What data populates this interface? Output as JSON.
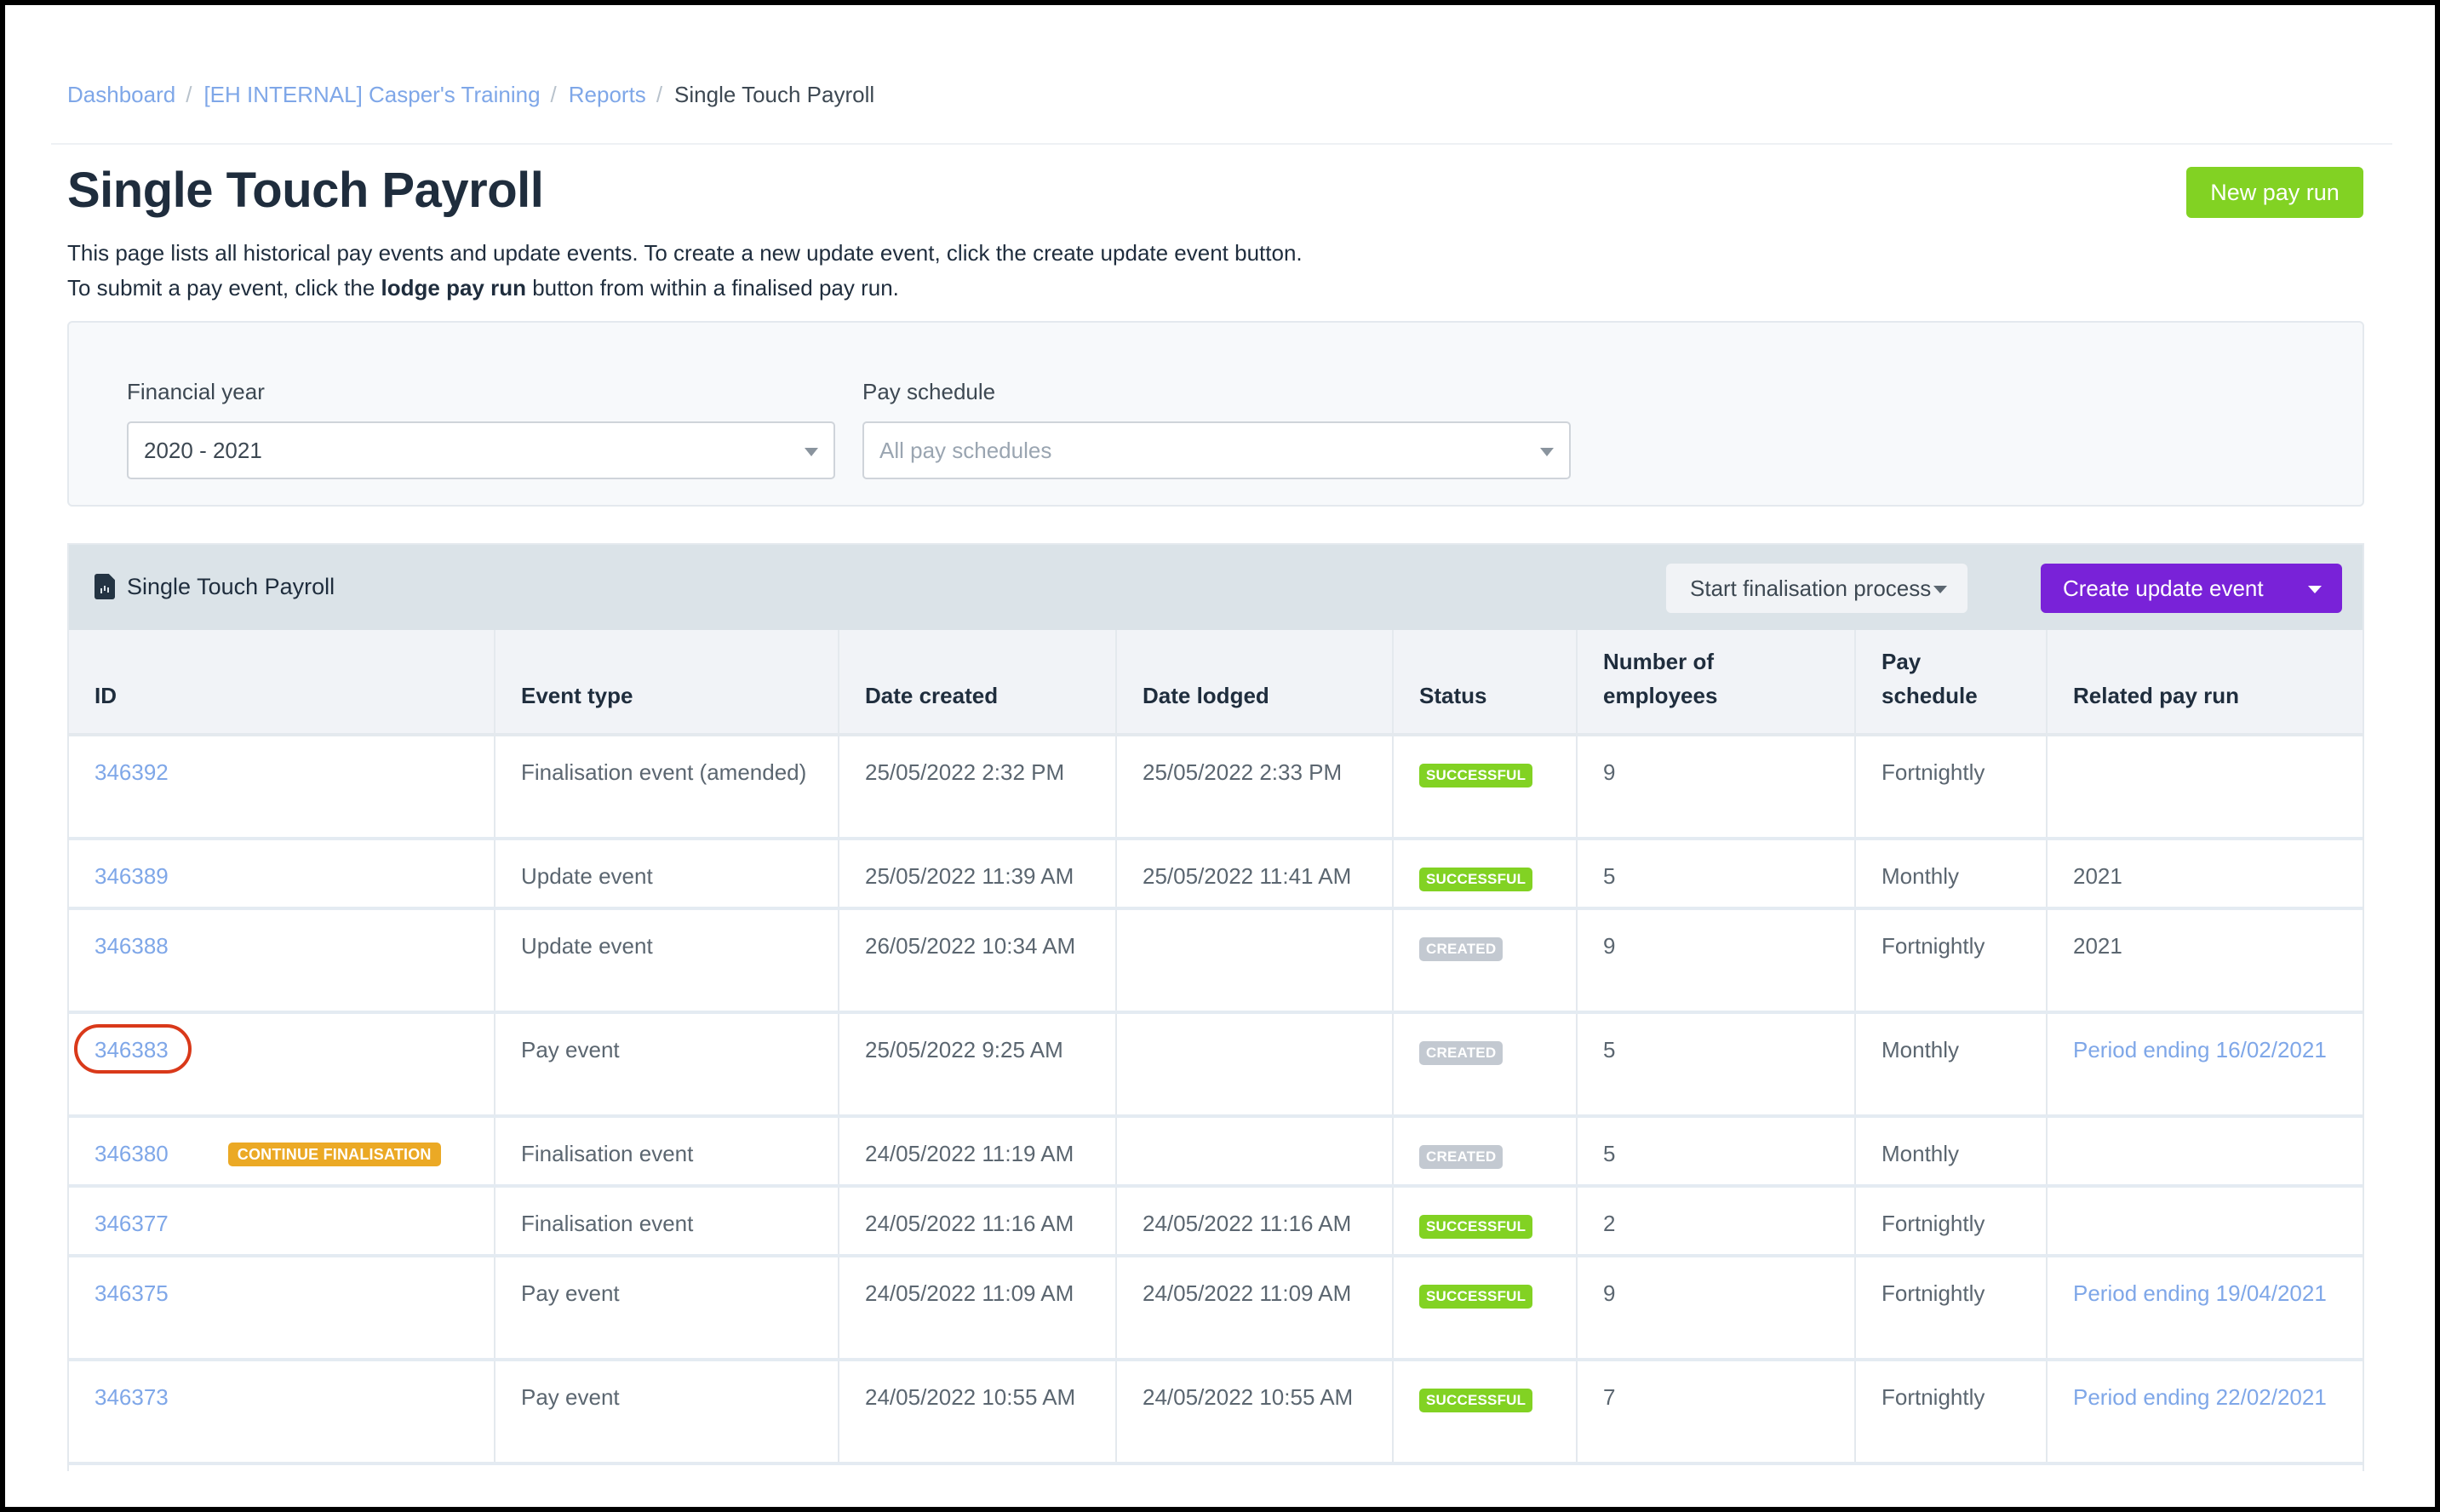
{
  "breadcrumb": [
    {
      "label": "Dashboard",
      "link": true
    },
    {
      "label": "[EH INTERNAL] Casper's Training",
      "link": true
    },
    {
      "label": "Reports",
      "link": true
    },
    {
      "label": "Single Touch Payroll",
      "link": false
    }
  ],
  "breadcrumb_separator": "/",
  "page": {
    "title": "Single Touch Payroll",
    "new_pay_run_label": "New pay run",
    "description_line1": "This page lists all historical pay events and update events. To create a new update event, click the create update event button.",
    "description_line2_prefix": "To submit a pay event, click the ",
    "description_line2_bold": "lodge pay run",
    "description_line2_suffix": " button from within a finalised pay run."
  },
  "filters": {
    "financial_year": {
      "label": "Financial year",
      "value": "2020 - 2021"
    },
    "pay_schedule": {
      "label": "Pay schedule",
      "placeholder": "All pay schedules"
    }
  },
  "panel": {
    "title": "Single Touch Payroll",
    "icon": "report-document-icon",
    "start_finalisation_label": "Start finalisation process",
    "create_update_event_label": "Create update event"
  },
  "table": {
    "columns": [
      "ID",
      "Event type",
      "Date created",
      "Date lodged",
      "Status",
      "Number of employees",
      "Pay schedule",
      "Related pay run"
    ],
    "rows": [
      {
        "id": "346392",
        "action": "",
        "event_type": "Finalisation event (amended)",
        "date_created": "25/05/2022 2:32 PM",
        "date_lodged": "25/05/2022 2:33 PM",
        "status": "SUCCESSFUL",
        "employees": "9",
        "pay_schedule": "Fortnightly",
        "related_pay_run": "",
        "related_link": false,
        "highlighted": false
      },
      {
        "id": "346389",
        "action": "",
        "event_type": "Update event",
        "date_created": "25/05/2022 11:39 AM",
        "date_lodged": "25/05/2022 11:41 AM",
        "status": "SUCCESSFUL",
        "employees": "5",
        "pay_schedule": "Monthly",
        "related_pay_run": "2021",
        "related_link": false,
        "highlighted": false
      },
      {
        "id": "346388",
        "action": "",
        "event_type": "Update event",
        "date_created": "26/05/2022 10:34 AM",
        "date_lodged": "",
        "status": "CREATED",
        "employees": "9",
        "pay_schedule": "Fortnightly",
        "related_pay_run": "2021",
        "related_link": false,
        "highlighted": false
      },
      {
        "id": "346383",
        "action": "",
        "event_type": "Pay event",
        "date_created": "25/05/2022 9:25 AM",
        "date_lodged": "",
        "status": "CREATED",
        "employees": "5",
        "pay_schedule": "Monthly",
        "related_pay_run": "Period ending 16/02/2021",
        "related_link": true,
        "highlighted": true
      },
      {
        "id": "346380",
        "action": "CONTINUE FINALISATION",
        "event_type": "Finalisation event",
        "date_created": "24/05/2022 11:19 AM",
        "date_lodged": "",
        "status": "CREATED",
        "employees": "5",
        "pay_schedule": "Monthly",
        "related_pay_run": "",
        "related_link": false,
        "highlighted": false
      },
      {
        "id": "346377",
        "action": "",
        "event_type": "Finalisation event",
        "date_created": "24/05/2022 11:16 AM",
        "date_lodged": "24/05/2022 11:16 AM",
        "status": "SUCCESSFUL",
        "employees": "2",
        "pay_schedule": "Fortnightly",
        "related_pay_run": "",
        "related_link": false,
        "highlighted": false
      },
      {
        "id": "346375",
        "action": "",
        "event_type": "Pay event",
        "date_created": "24/05/2022 11:09 AM",
        "date_lodged": "24/05/2022 11:09 AM",
        "status": "SUCCESSFUL",
        "employees": "9",
        "pay_schedule": "Fortnightly",
        "related_pay_run": "Period ending 19/04/2021",
        "related_link": true,
        "highlighted": false
      },
      {
        "id": "346373",
        "action": "",
        "event_type": "Pay event",
        "date_created": "24/05/2022 10:55 AM",
        "date_lodged": "24/05/2022 10:55 AM",
        "status": "SUCCESSFUL",
        "employees": "7",
        "pay_schedule": "Fortnightly",
        "related_pay_run": "Period ending 22/02/2021",
        "related_link": true,
        "highlighted": false
      }
    ]
  },
  "colors": {
    "brand_green": "#82d223",
    "brand_purple": "#7922d8",
    "link_blue": "#7fa7e8",
    "status_created": "#c3c9d1",
    "continue_orange": "#eba925",
    "highlight_red": "#d9391a"
  }
}
